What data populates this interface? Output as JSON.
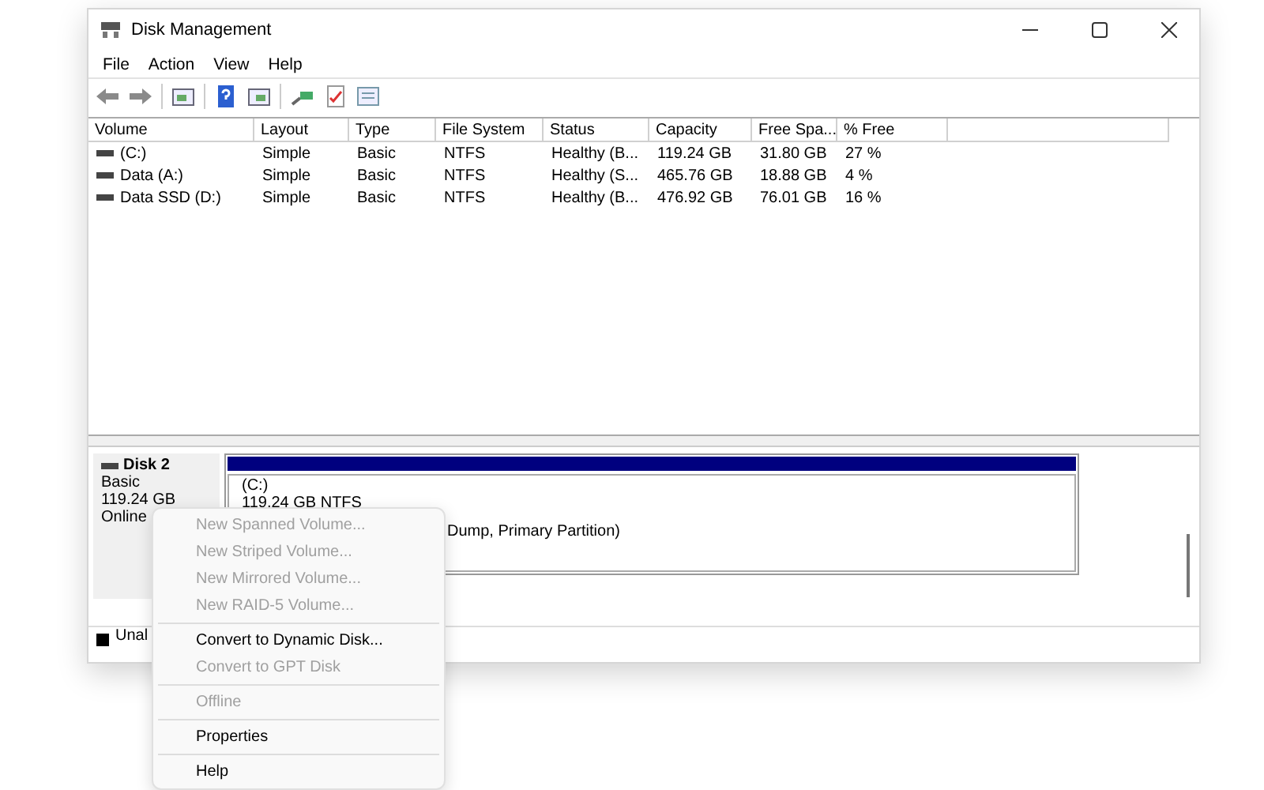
{
  "window": {
    "title": "Disk Management"
  },
  "menu_bar": [
    "File",
    "Action",
    "View",
    "Help"
  ],
  "table": {
    "columns": [
      "Volume",
      "Layout",
      "Type",
      "File System",
      "Status",
      "Capacity",
      "Free Spa...",
      "% Free"
    ],
    "rows": [
      [
        "(C:)",
        "Simple",
        "Basic",
        "NTFS",
        "Healthy (B...",
        "119.24 GB",
        "31.80 GB",
        "27 %"
      ],
      [
        "Data (A:)",
        "Simple",
        "Basic",
        "NTFS",
        "Healthy (S...",
        "465.76 GB",
        "18.88 GB",
        "4 %"
      ],
      [
        "Data SSD (D:)",
        "Simple",
        "Basic",
        "NTFS",
        "Healthy (B...",
        "476.92 GB",
        "76.01 GB",
        "16 %"
      ]
    ]
  },
  "disk": {
    "name": "Disk 2",
    "type": "Basic",
    "size": "119.24 GB",
    "state": "Online",
    "partition": {
      "label": "(C:)",
      "size": "119.24 GB NTFS",
      "status": "Dump, Primary Partition)"
    }
  },
  "legend": [
    {
      "label": "Unal",
      "color": "#000000"
    }
  ],
  "context_menu": {
    "groups": [
      [
        {
          "label": "New Spanned Volume...",
          "disabled": true
        },
        {
          "label": "New Striped Volume...",
          "disabled": true
        },
        {
          "label": "New Mirrored Volume...",
          "disabled": true
        },
        {
          "label": "New RAID-5 Volume...",
          "disabled": true
        }
      ],
      [
        {
          "label": "Convert to Dynamic Disk...",
          "disabled": false
        },
        {
          "label": "Convert to GPT Disk",
          "disabled": true
        }
      ],
      [
        {
          "label": "Offline",
          "disabled": true
        }
      ],
      [
        {
          "label": "Properties",
          "disabled": false
        }
      ],
      [
        {
          "label": "Help",
          "disabled": false
        }
      ]
    ]
  }
}
